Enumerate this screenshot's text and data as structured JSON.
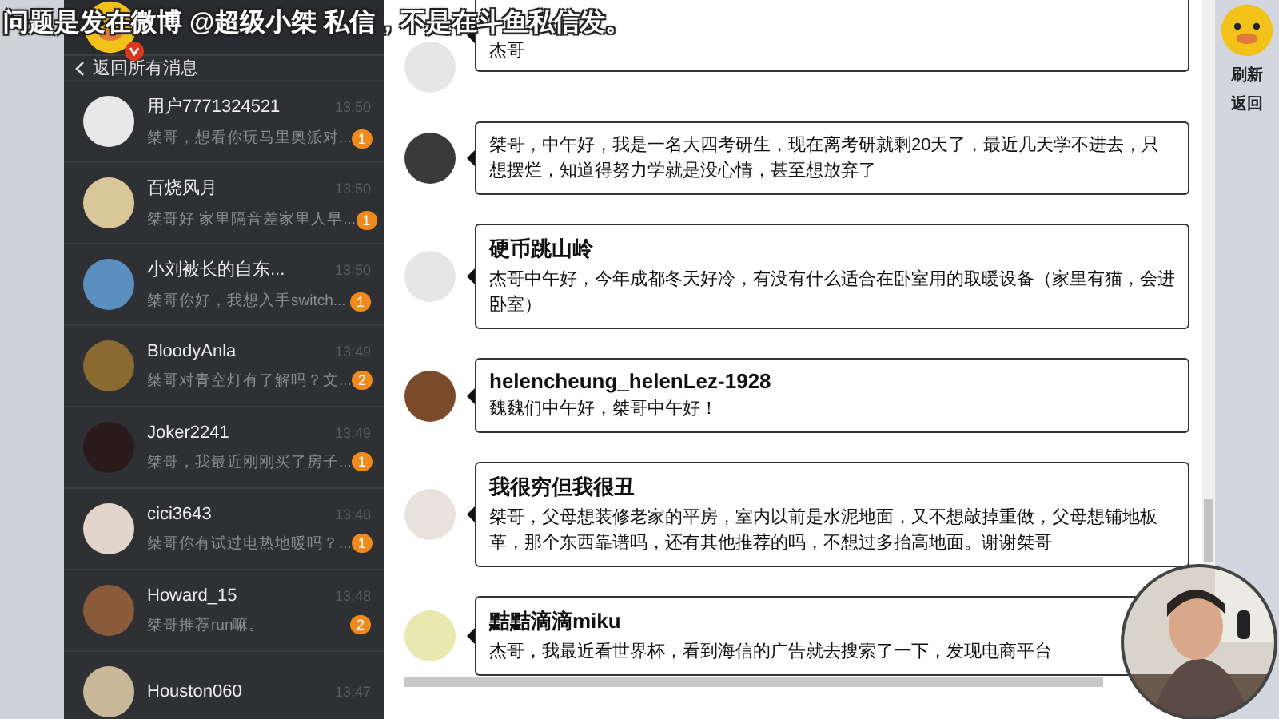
{
  "caption": "问题是发在微博 @超级小桀 私信，不是在斗鱼私信发。",
  "sidebar": {
    "back_link": "返回所有消息",
    "conversations": [
      {
        "name": "用户7771324521",
        "preview": "桀哥，想看你玩马里奥派对...",
        "time": "13:50",
        "badge": "1"
      },
      {
        "name": "百烧风月",
        "preview": "桀哥好 家里隔音差家里人早...",
        "time": "13:50",
        "badge": "1"
      },
      {
        "name": "小刘被长的自东...",
        "preview": "桀哥你好，我想入手switch...",
        "time": "13:50",
        "badge": "1"
      },
      {
        "name": "BloodyAnla",
        "preview": "桀哥对青空灯有了解吗？文...",
        "time": "13:49",
        "badge": "2"
      },
      {
        "name": "Joker2241",
        "preview": "桀哥，我最近刚刚买了房子...",
        "time": "13:49",
        "badge": "1"
      },
      {
        "name": "cici3643",
        "preview": "桀哥你有试过电热地暖吗？...",
        "time": "13:48",
        "badge": "1"
      },
      {
        "name": "Howard_15",
        "preview": "桀哥推荐run嘛。",
        "time": "13:48",
        "badge": "2"
      },
      {
        "name": "Houston060",
        "time": "13:47"
      }
    ]
  },
  "messages": [
    {
      "text": "杰哥"
    },
    {
      "text": "桀哥，中午好，我是一名大四考研生，现在离考研就剩20天了，最近几天学不进去，只想摆烂，知道得努力学就是没心情，甚至想放弃了"
    },
    {
      "sender": "硬币跳山岭",
      "text": "杰哥中午好，今年成都冬天好冷，有没有什么适合在卧室用的取暖设备（家里有猫，会进卧室）"
    },
    {
      "sender": "helencheung_helenLez-1928",
      "text": "魏魏们中午好，桀哥中午好！"
    },
    {
      "sender": "我很穷但我很丑",
      "text": "桀哥，父母想装修老家的平房，室内以前是水泥地面，又不想敲掉重做，父母想铺地板革，那个东西靠谱吗，还有其他推荐的吗，不想过多抬高地面。谢谢桀哥"
    },
    {
      "sender": "黠黠滴滴miku",
      "text": "杰哥，我最近看世界杯，看到海信的广告就去搜索了一下，发现电商平台"
    }
  ],
  "side_panel": {
    "buttons": [
      "刷新",
      "返回"
    ]
  }
}
